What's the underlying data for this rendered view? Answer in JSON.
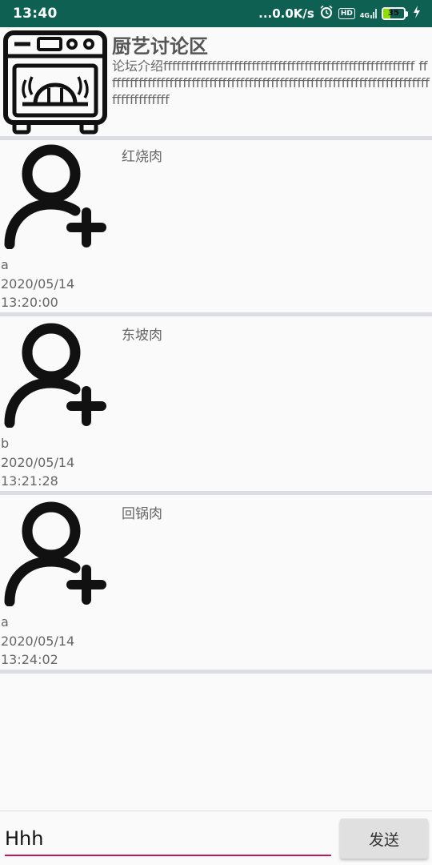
{
  "status_bar": {
    "time": "13:40",
    "network_speed": "...0.0K/s",
    "hd": "HD",
    "signal": "4G",
    "battery": "35",
    "battery_level_percent": 35,
    "battery_color": "#8be000",
    "background": "#0e6152"
  },
  "forum": {
    "title": "厨艺讨论区",
    "intro": "论坛介绍fffffffffffffffffffffffffffffffffffffffffffffffffffffffff fffffffffffffffffffffffffffffffffffffffffffffffffffffffffffffffffffffffffffffffffffffff",
    "logo_icon": "dishwasher-icon"
  },
  "posts": [
    {
      "title": "红烧肉",
      "author": "a",
      "date": "2020/05/14",
      "time": "13:20:00",
      "avatar_icon": "add-user-icon"
    },
    {
      "title": "东坡肉",
      "author": "b",
      "date": "2020/05/14",
      "time": "13:21:28",
      "avatar_icon": "add-user-icon"
    },
    {
      "title": "回锅肉",
      "author": "a",
      "date": "2020/05/14",
      "time": "13:24:02",
      "avatar_icon": "add-user-icon"
    }
  ],
  "compose": {
    "input_value": "Hhh",
    "send_label": "发送",
    "accent_color": "#c2185b"
  }
}
